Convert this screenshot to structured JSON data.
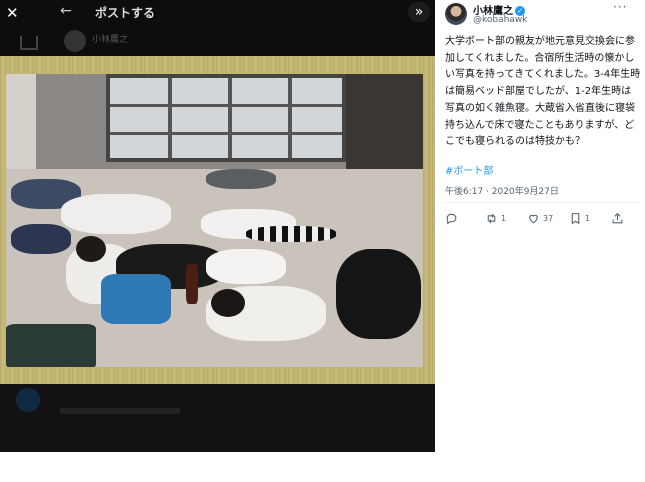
{
  "viewer": {
    "close_glyph": "✕",
    "back_glyph": "←",
    "title": "ポストする",
    "expand_glyph": "»",
    "ghost_name": "小林鷹之"
  },
  "tweet": {
    "display_name": "小林鷹之",
    "verified": true,
    "handle": "@kobahawk",
    "more_glyph": "···",
    "text": "大学ボート部の親友が地元意見交換会に参加してくれました。合宿所生活時の懐かしい写真を持ってきてくれました。3-4年生時は簡易ベッド部屋でしたが、1-2年生時は写真の如く雑魚寝。大蔵省入省直後に寝袋持ち込んで床で寝たこともありますが、どこでも寝られるのは特技かも？",
    "hashtag": "#ボート部",
    "timestamp": "午後6:17 · 2020年9月27日",
    "actions": [
      {
        "icon": "reply-icon",
        "count": ""
      },
      {
        "icon": "retweet-icon",
        "count": "1"
      },
      {
        "icon": "like-icon",
        "count": "37"
      },
      {
        "icon": "bookmark-icon",
        "count": "1"
      },
      {
        "icon": "share-icon",
        "count": ""
      }
    ]
  },
  "colors": {
    "accent": "#1d9bf0",
    "text": "#0f1419",
    "muted": "#536471",
    "viewer_bg": "#0d0d0d"
  }
}
